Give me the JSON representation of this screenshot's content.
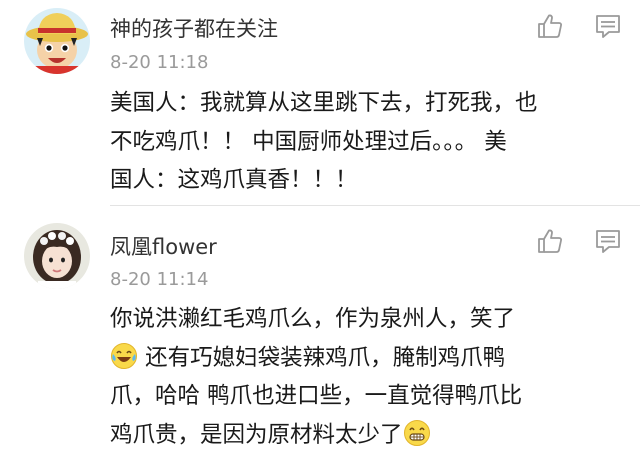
{
  "comments": [
    {
      "username": "神的孩子都在关注",
      "time": "8-20 11:18",
      "avatar": "one-piece-luffy-avatar",
      "lines": [
        "美国人：我就算从这里跳下去，打死我，也",
        "不吃鸡爪！！ 中国厨师处理过后。。。 美",
        "国人：这鸡爪真香！！！"
      ]
    },
    {
      "username": "凤凰flower",
      "time": "8-20 11:14",
      "avatar": "girl-photo-avatar",
      "line1": "你说洪濑红毛鸡爪么，作为泉州人，笑了",
      "line2": "还有巧媳妇袋装辣鸡爪，腌制鸡爪鸭",
      "line3": "爪，哈哈 鸭爪也进口些，一直觉得鸭爪比",
      "line4": "鸡爪贵，是因为原材料太少了"
    }
  ],
  "icons": {
    "like": "thumbs-up-icon",
    "reply": "comment-bubble-icon"
  },
  "colors": {
    "username": "#333333",
    "time": "#9a9a9a",
    "body": "#1a1a1a",
    "icon": "#9a9a9a"
  }
}
